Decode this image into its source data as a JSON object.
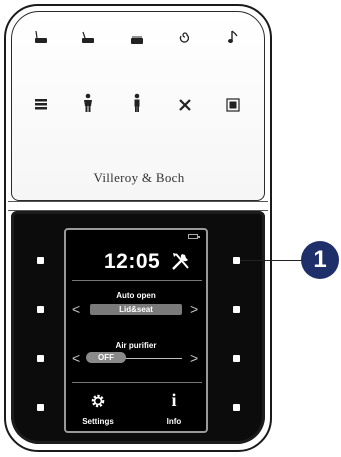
{
  "brand": "Villeroy & Boch",
  "top_icons_row1": [
    "rear-wash-icon",
    "lady-wash-icon",
    "dryer-icon",
    "spiral-icon",
    "music-note-icon"
  ],
  "top_icons_row2": [
    "stack-icon",
    "person-icon",
    "person-standing-icon",
    "fan-icon",
    "square-icon"
  ],
  "screen": {
    "time": "12:05",
    "auto_open_label": "Auto open",
    "auto_open_value": "Lid&seat",
    "air_purifier_label": "Air purifier",
    "air_purifier_value": "OFF",
    "settings_label": "Settings",
    "info_label": "Info",
    "info_glyph": "i"
  },
  "callout": "1",
  "colors": {
    "callout_bg": "#1f2f6a",
    "panel_dark": "#0c0c0c",
    "pill": "#7a7a7a"
  }
}
